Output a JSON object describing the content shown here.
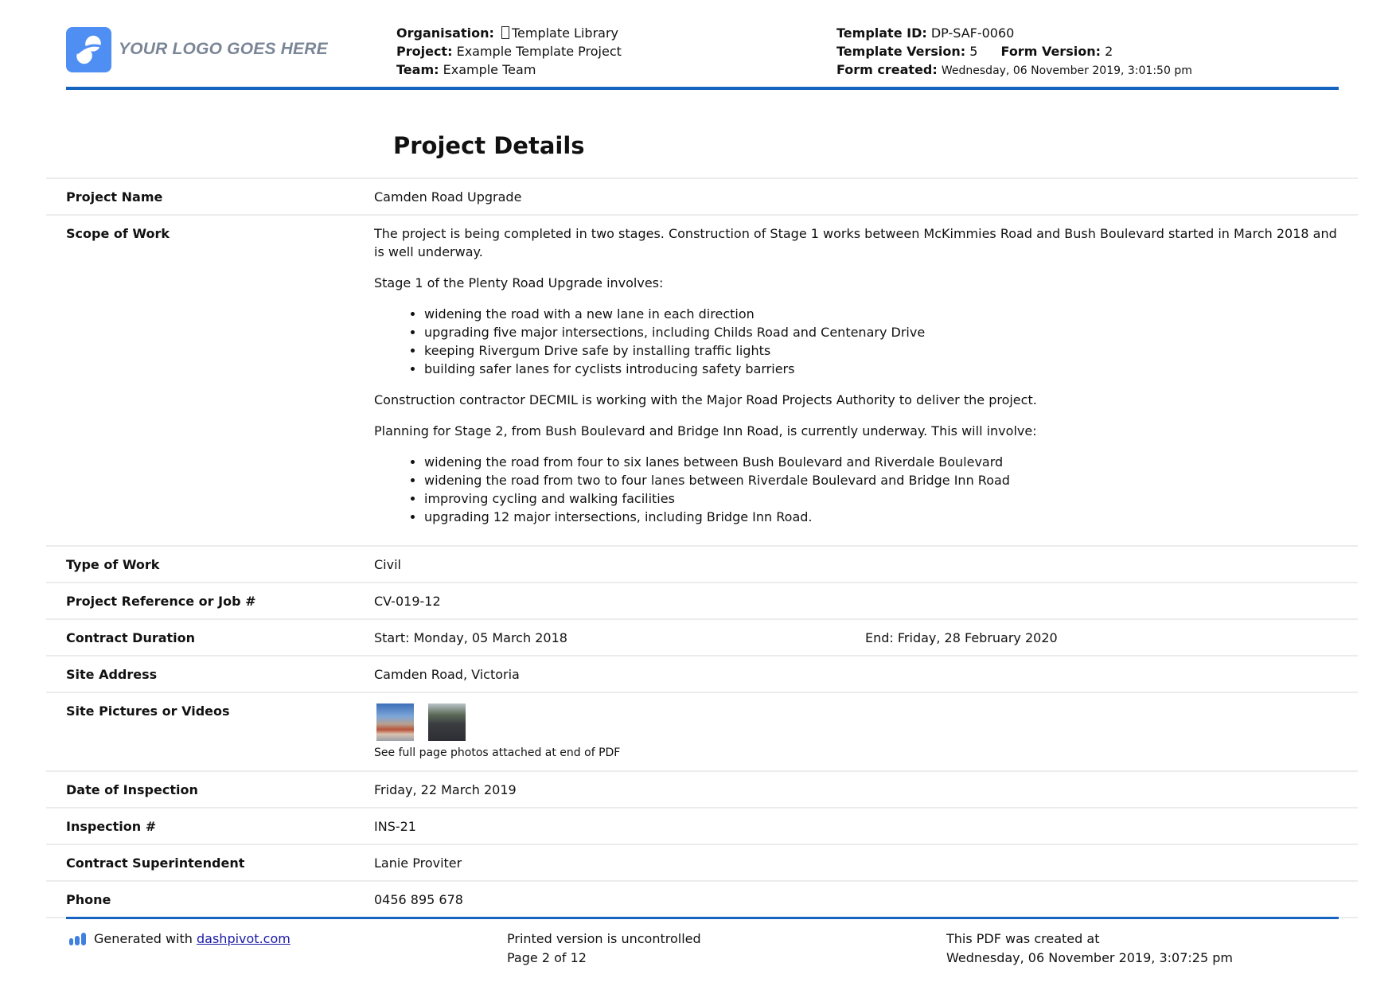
{
  "header": {
    "logo_text": "YOUR LOGO GOES HERE",
    "organisation_label": "Organisation:",
    "organisation_icon": "missing-glyph-icon",
    "organisation_value": "Template Library",
    "project_label": "Project:",
    "project_value": "Example Template Project",
    "team_label": "Team:",
    "team_value": "Example Team",
    "template_id_label": "Template ID:",
    "template_id_value": "DP-SAF-0060",
    "template_version_label": "Template Version:",
    "template_version_value": "5",
    "form_version_label": "Form Version:",
    "form_version_value": "2",
    "form_created_label": "Form created:",
    "form_created_value": "Wednesday, 06 November 2019, 3:01:50 pm"
  },
  "section": {
    "title": "Project Details"
  },
  "rows": {
    "project_name": {
      "label": "Project Name",
      "value": "Camden Road Upgrade"
    },
    "scope_of_work": {
      "label": "Scope of Work",
      "para1": "The project is being completed in two stages. Construction of Stage 1 works between McKimmies Road and Bush Boulevard started in March 2018 and is well underway.",
      "para2": "Stage 1 of the Plenty Road Upgrade involves:",
      "list1": [
        "widening the road with a new lane in each direction",
        "upgrading five major intersections, including Childs Road and Centenary Drive",
        "keeping Rivergum Drive safe by installing traffic lights",
        "building safer lanes for cyclists introducing safety barriers"
      ],
      "para3": "Construction contractor DECMIL is working with the Major Road Projects Authority to deliver the project.",
      "para4": "Planning for Stage 2, from Bush Boulevard and Bridge Inn Road, is currently underway. This will involve:",
      "list2": [
        "widening the road from four to six lanes between Bush Boulevard and Riverdale Boulevard",
        "widening the road from two to four lanes between Riverdale Boulevard and Bridge Inn Road",
        "improving cycling and walking facilities",
        "upgrading 12 major intersections, including Bridge Inn Road."
      ]
    },
    "type_of_work": {
      "label": "Type of Work",
      "value": "Civil"
    },
    "project_reference": {
      "label": "Project Reference or Job #",
      "value": "CV-019-12"
    },
    "contract_duration": {
      "label": "Contract Duration",
      "start": "Start: Monday, 05 March 2018",
      "end": "End: Friday, 28 February 2020"
    },
    "site_address": {
      "label": "Site Address",
      "value": "Camden Road, Victoria"
    },
    "site_pictures": {
      "label": "Site Pictures or Videos",
      "photos": [
        "site-photo-roadworks",
        "site-photo-road"
      ],
      "note": "See full page photos attached at end of PDF"
    },
    "date_of_inspection": {
      "label": "Date of Inspection",
      "value": "Friday, 22 March 2019"
    },
    "inspection_number": {
      "label": "Inspection #",
      "value": "INS-21"
    },
    "contract_superintendent": {
      "label": "Contract Superintendent",
      "value": "Lanie Proviter"
    },
    "phone": {
      "label": "Phone",
      "value": "0456 895 678"
    }
  },
  "footer": {
    "generated_prefix": "Generated with ",
    "generated_link": "dashpivot.com",
    "uncontrolled": "Printed version is uncontrolled",
    "page": "Page 2 of 12",
    "created_label": "This PDF was created at",
    "created_value": "Wednesday, 06 November 2019, 3:07:25 pm"
  },
  "colors": {
    "accent_rule": "#1565c0",
    "logo_blue": "#4f8ef2",
    "link": "#1a1aa6",
    "row_border": "#ececec"
  }
}
